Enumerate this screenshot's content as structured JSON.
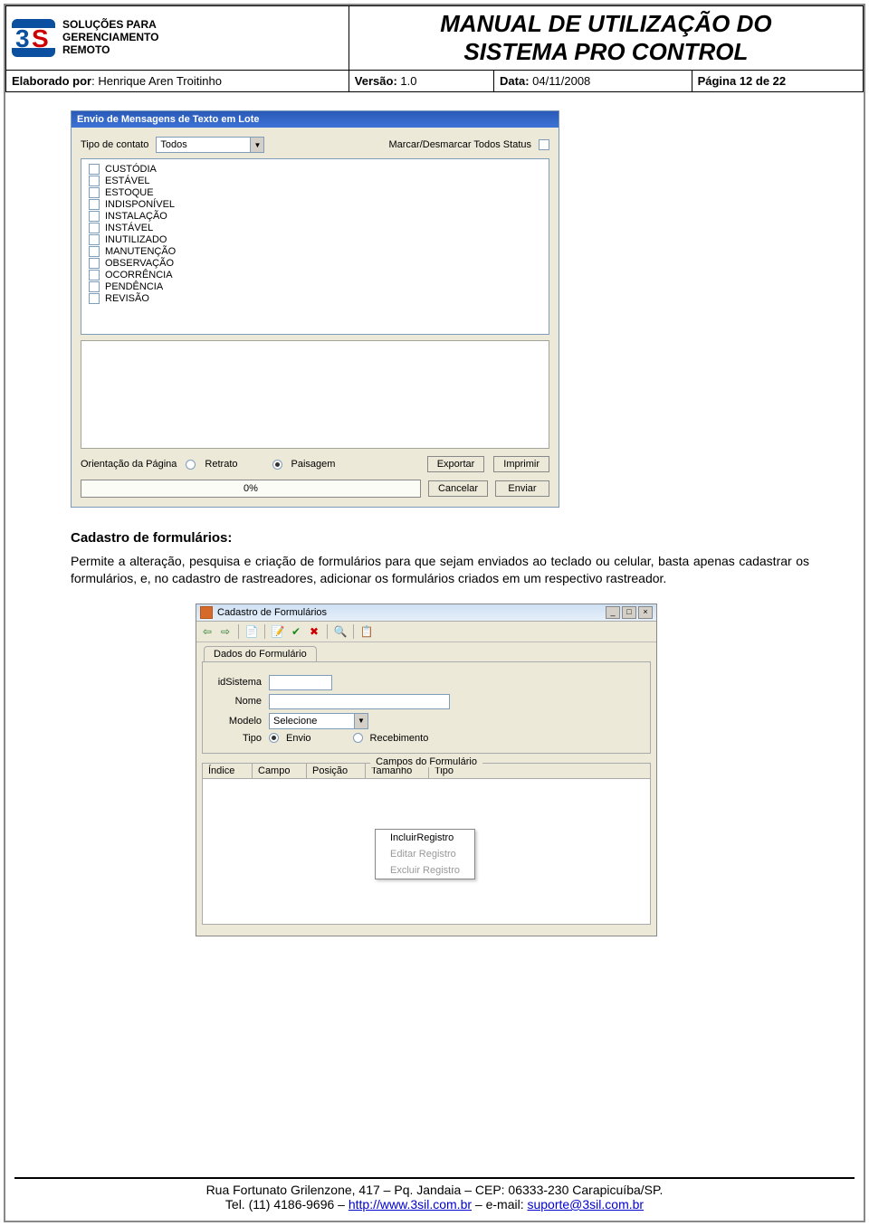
{
  "header": {
    "logo_text_l1": "SOLUÇÕES PARA",
    "logo_text_l2": "GERENCIAMENTO",
    "logo_text_l3": "REMOTO",
    "title_l1": "MANUAL DE UTILIZAÇÃO DO",
    "title_l2": "SISTEMA PRO CONTROL",
    "elaborado_label": "Elaborado por",
    "elaborado_value": ": Henrique Aren Troitinho",
    "versao_label": "Versão:",
    "versao_value": " 1.0",
    "data_label": "Data:",
    "data_value": " 04/11/2008",
    "pagina": "Página 12 de 22"
  },
  "win1": {
    "title": "Envio de Mensagens de Texto em Lote",
    "tipo_contato_label": "Tipo de contato",
    "tipo_contato_value": "Todos",
    "marcar_label": "Marcar/Desmarcar Todos Status",
    "status_items": [
      "CUSTÓDIA",
      "ESTÁVEL",
      "ESTOQUE",
      "INDISPONÍVEL",
      "INSTALAÇÃO",
      "INSTÁVEL",
      "INUTILIZADO",
      "MANUTENÇÃO",
      "OBSERVAÇÃO",
      "OCORRÊNCIA",
      "PENDÊNCIA",
      "REVISÃO"
    ],
    "orientacao_label": "Orientação da Página",
    "retrato": "Retrato",
    "paisagem": "Paisagem",
    "exportar": "Exportar",
    "imprimir": "Imprimir",
    "progress": "0%",
    "cancelar": "Cancelar",
    "enviar": "Enviar"
  },
  "body": {
    "heading": "Cadastro de formulários:",
    "para": "Permite a alteração, pesquisa e criação de formulários para que sejam enviados ao teclado ou celular, basta apenas cadastrar os formulários, e, no cadastro de rastreadores, adicionar os formulários criados em um respectivo rastreador."
  },
  "win2": {
    "title": "Cadastro de Formulários",
    "tab": "Dados do Formulário",
    "lbl_idsistema": "idSistema",
    "lbl_nome": "Nome",
    "lbl_modelo": "Modelo",
    "modelo_value": "Selecione",
    "lbl_tipo": "Tipo",
    "tipo_envio": "Envio",
    "tipo_receb": "Recebimento",
    "campos_legend": "Campos do Formulário",
    "cols": {
      "indice": "Índice",
      "campo": "Campo",
      "posicao": "Posição",
      "tamanho": "Tamanho",
      "tipo": "Tipo"
    },
    "ctx": {
      "incluir": "IncluirRegistro",
      "editar": "Editar Registro",
      "excluir": "Excluir Registro"
    }
  },
  "footer": {
    "line1_a": "Rua Fortunato Grilenzone, 417 – Pq. Jandaia – CEP: 06333-230 Carapicuíba/SP.",
    "line2_a": "Tel. (11) 4186-9696 – ",
    "url": "http://www.3sil.com.br",
    "line2_b": " – e-mail: ",
    "email": "suporte@3sil.com.br"
  }
}
